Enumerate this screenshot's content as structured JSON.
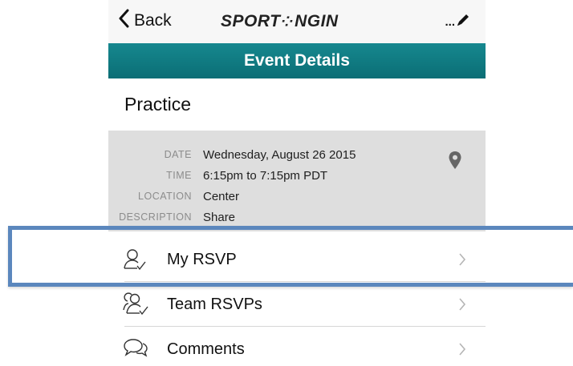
{
  "nav": {
    "back_label": "Back",
    "logo_left": "SPORT",
    "logo_mark": "⁘",
    "logo_right": "NGIN",
    "edit_label": "..."
  },
  "header": {
    "title": "Event Details"
  },
  "event": {
    "name": "Practice"
  },
  "details": {
    "date_label": "DATE",
    "date_value": "Wednesday, August 26 2015",
    "time_label": "TIME",
    "time_value": "6:15pm to 7:15pm PDT",
    "location_label": "LOCATION",
    "location_value": "Center",
    "description_label": "DESCRIPTION",
    "description_value": "Share"
  },
  "list": {
    "my_rsvp": "My RSVP",
    "team_rsvps": "Team RSVPs",
    "comments": "Comments"
  },
  "colors": {
    "header_bg": "#0f7b82",
    "details_bg": "#dedede",
    "highlight": "#5b87bd"
  },
  "icons": {
    "back": "chevron-left-icon",
    "edit": "pencil-icon",
    "location": "map-pin-icon",
    "my_rsvp": "user-check-icon",
    "team_rsvps": "users-check-icon",
    "comments": "chat-bubbles-icon",
    "chevron": "chevron-right-icon"
  }
}
